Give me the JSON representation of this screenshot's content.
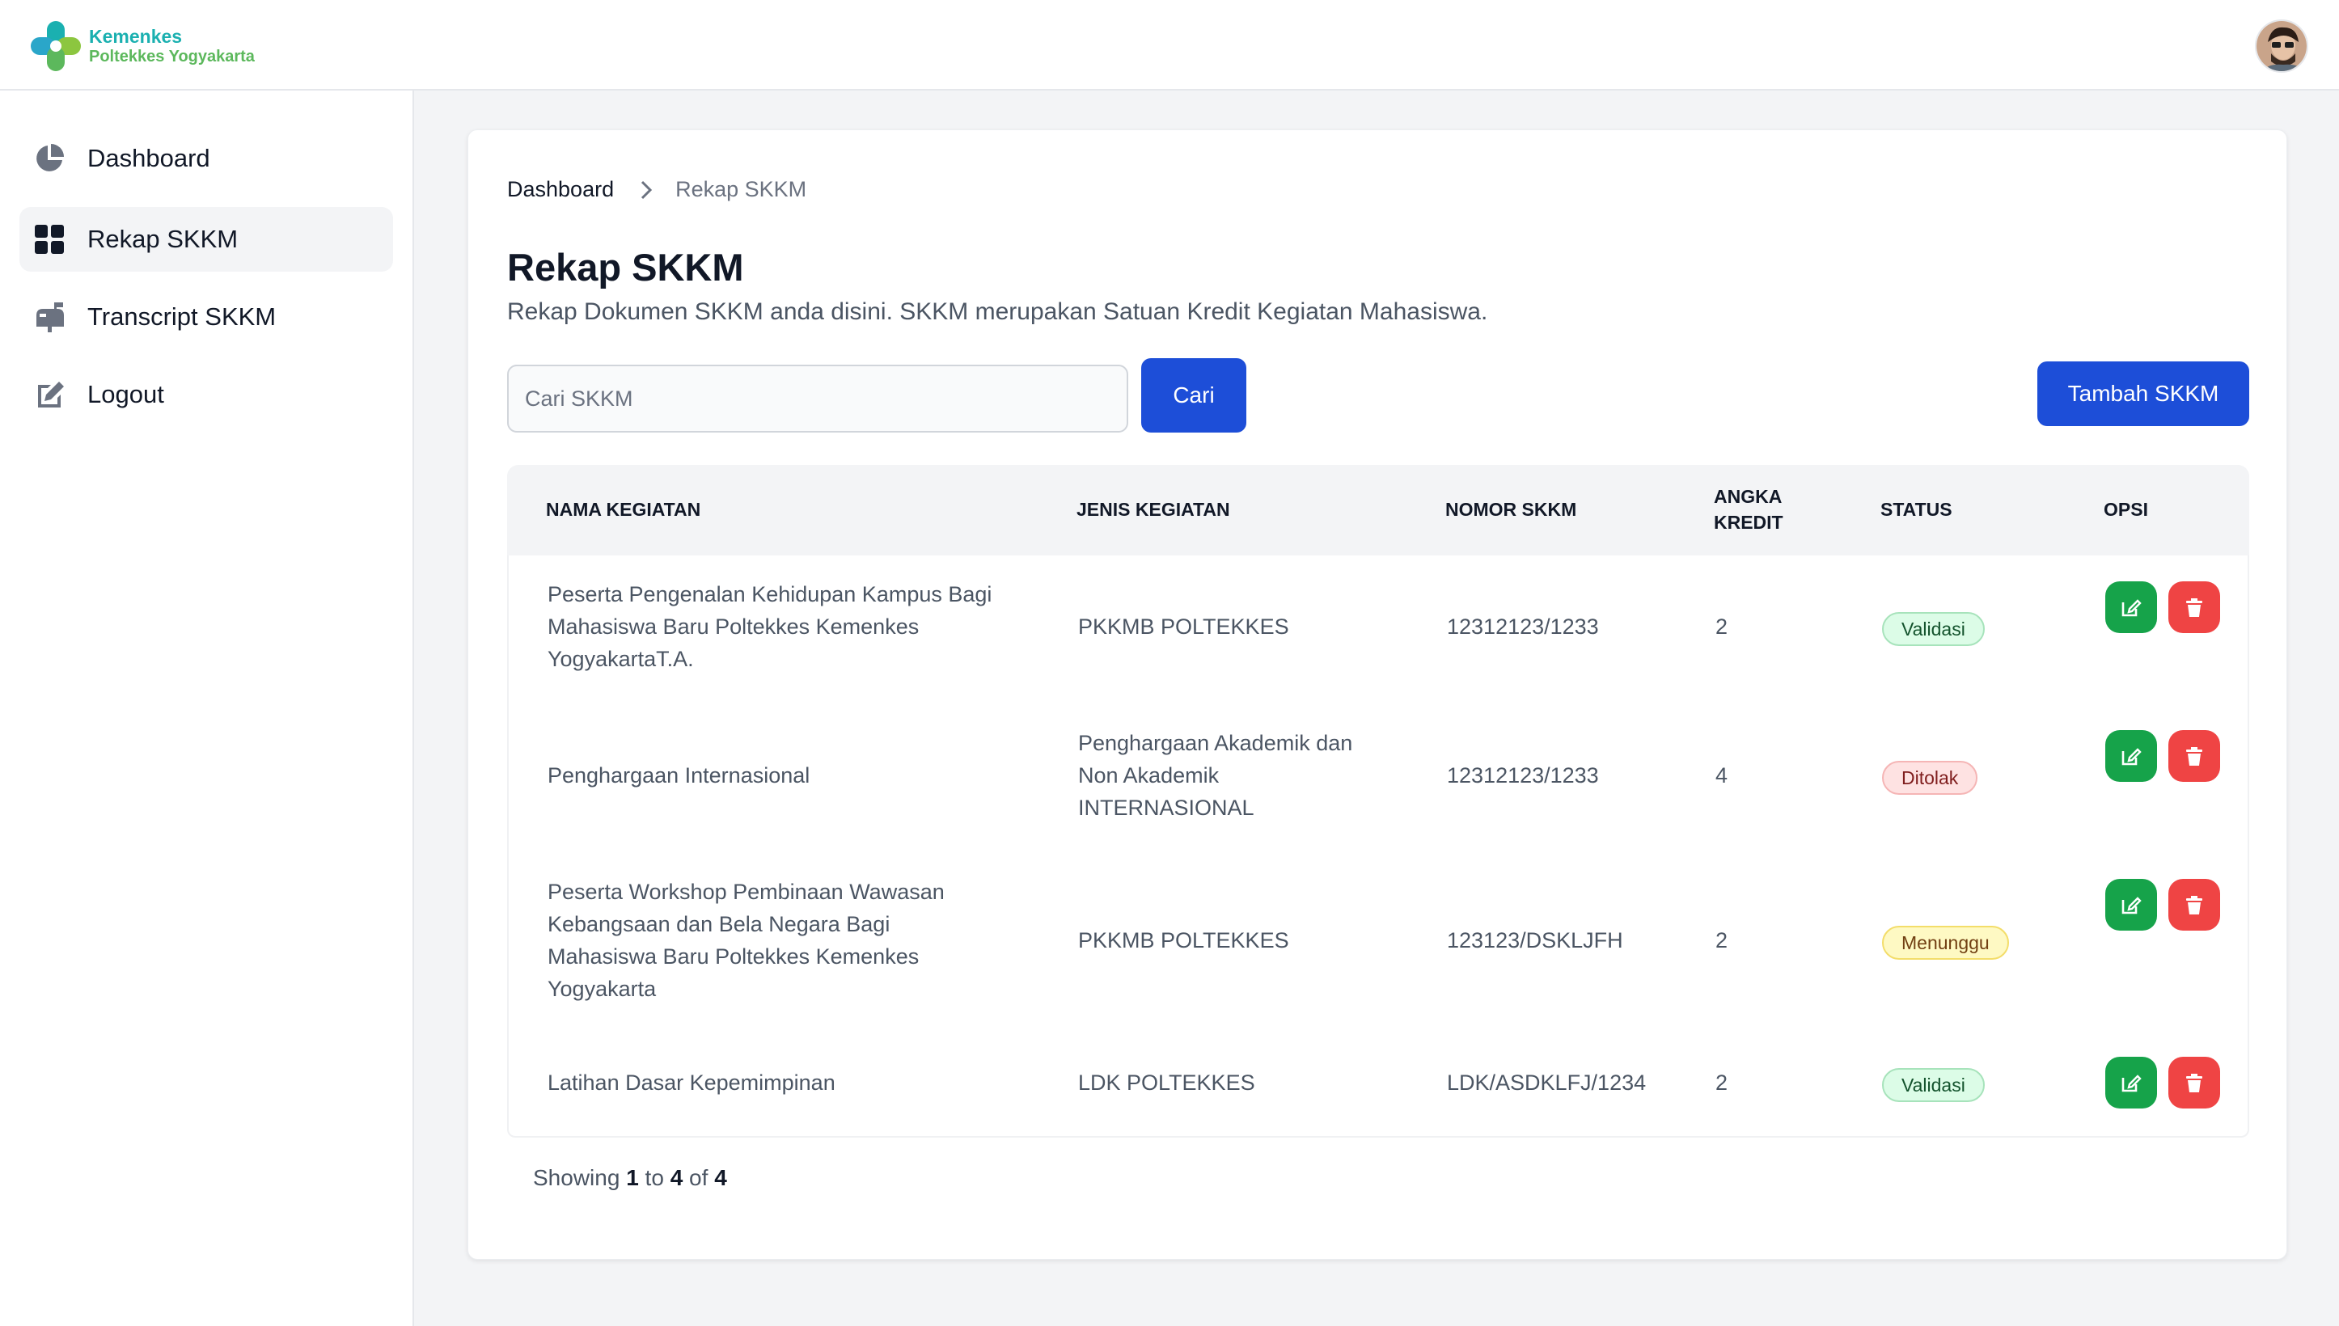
{
  "brand": {
    "line1": "Kemenkes",
    "line2": "Poltekkes Yogyakarta"
  },
  "sidebar": {
    "items": [
      {
        "label": "Dashboard",
        "icon": "pie-chart-icon"
      },
      {
        "label": "Rekap SKKM",
        "icon": "grid-icon",
        "active": true
      },
      {
        "label": "Transcript SKKM",
        "icon": "mailbox-icon"
      },
      {
        "label": "Logout",
        "icon": "pen-square-icon"
      }
    ]
  },
  "breadcrumb": {
    "home": "Dashboard",
    "current": "Rekap SKKM"
  },
  "page": {
    "title": "Rekap SKKM",
    "subtitle": "Rekap Dokumen SKKM anda disini. SKKM merupakan Satuan Kredit Kegiatan Mahasiswa."
  },
  "search": {
    "placeholder": "Cari SKKM",
    "value": "",
    "button_label": "Cari"
  },
  "add_button_label": "Tambah SKKM",
  "table": {
    "headers": {
      "nama": "NAMA KEGIATAN",
      "jenis": "JENIS KEGIATAN",
      "nomor": "NOMOR SKKM",
      "angka1": "ANGKA",
      "angka2": "KREDIT",
      "status": "STATUS",
      "opsi": "OPSI"
    },
    "rows": [
      {
        "nama": [
          "Peserta Pengenalan Kehidupan Kampus Bagi",
          "Mahasiswa Baru Poltekkes Kemenkes",
          "YogyakartaT.A."
        ],
        "jenis": [
          "PKKMB POLTEKKES"
        ],
        "nomor": "12312123/1233",
        "kredit": "2",
        "status": "Validasi",
        "status_color": "#16a34a"
      },
      {
        "nama": [
          "Penghargaan Internasional"
        ],
        "jenis": [
          "Penghargaan Akademik dan",
          "Non Akademik",
          "INTERNASIONAL"
        ],
        "nomor": "12312123/1233",
        "kredit": "4",
        "status": "Ditolak",
        "status_color": "#dc2626"
      },
      {
        "nama": [
          "Peserta Workshop Pembinaan Wawasan",
          "Kebangsaan dan Bela Negara Bagi",
          "Mahasiswa Baru Poltekkes Kemenkes",
          "Yogyakarta"
        ],
        "jenis": [
          "PKKMB POLTEKKES"
        ],
        "nomor": "123123/DSKLJFH",
        "kredit": "2",
        "status": "Menunggu",
        "status_color": "#ca8a04"
      },
      {
        "nama": [
          "Latihan Dasar Kepemimpinan"
        ],
        "jenis": [
          "LDK POLTEKKES"
        ],
        "nomor": "LDK/ASDKLFJ/1234",
        "kredit": "2",
        "status": "Validasi",
        "status_color": "#16a34a"
      }
    ]
  },
  "pagination": {
    "prefix": "Showing",
    "from": "1",
    "to_word": "to",
    "to": "4",
    "of_word": "of",
    "total": "4"
  },
  "colors": {
    "primary": "#1d4ed8",
    "edit": "#16a34a",
    "delete": "#ef4444"
  }
}
